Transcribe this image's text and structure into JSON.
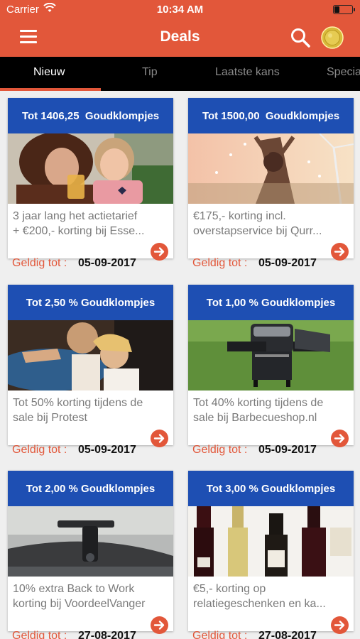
{
  "status_bar": {
    "carrier": "Carrier",
    "time": "10:34 AM",
    "battery_level": 0.3
  },
  "nav": {
    "title": "Deals",
    "icons": {
      "menu": "hamburger-menu-icon",
      "search": "search-icon",
      "coins": "gold-coin-icon"
    }
  },
  "tabs": [
    {
      "label": "Nieuw",
      "active": true
    },
    {
      "label": "Tip",
      "active": false
    },
    {
      "label": "Laatste kans",
      "active": false
    },
    {
      "label": "Specia",
      "active": false
    }
  ],
  "theme": {
    "accent": "#e2573a",
    "header_blue": "#1e4fb3",
    "background": "#efefef"
  },
  "valid_label": "Geldig tot :",
  "deals": [
    {
      "reward": "Tot 1406,25  Goudklompjes",
      "description": [
        "3 jaar lang het actietarief",
        "+ €200,- korting bij Esse..."
      ],
      "valid_until": "05-09-2017",
      "image": "mother-daughter-photo"
    },
    {
      "reward": "Tot 1500,00  Goudklompjes",
      "description": [
        "€175,- korting incl.",
        "overstapservice bij Qurr..."
      ],
      "valid_until": "05-09-2017",
      "image": "celebration-windmill-photo"
    },
    {
      "reward": "Tot 2,50 % Goudklompjes",
      "description": [
        "Tot 50% korting tijdens de",
        "sale bij Protest"
      ],
      "valid_until": "05-09-2017",
      "image": "surfers-photo"
    },
    {
      "reward": "Tot 1,00 % Goudklompjes",
      "description": [
        "Tot 40% korting tijdens de",
        "sale bij Barbecueshop.nl"
      ],
      "valid_until": "05-09-2017",
      "image": "barbecue-photo"
    },
    {
      "reward": "Tot 2,00 % Goudklompjes",
      "description": [
        "10% extra Back to Work",
        "korting bij VoordeelVanger"
      ],
      "valid_until": "27-08-2017",
      "image": "dashcam-photo"
    },
    {
      "reward": "Tot 3,00 % Goudklompjes",
      "description": [
        "€5,- korting op",
        "relatiegeschenken en ka..."
      ],
      "valid_until": "27-08-2017",
      "image": "wine-bottles-photo"
    }
  ]
}
